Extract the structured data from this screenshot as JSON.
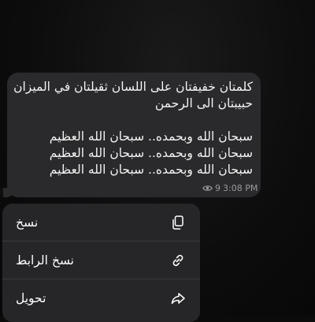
{
  "message": {
    "lines": [
      "كلمتان خفيفتان على اللسان ثقيلتان في الميزان",
      "حبيبتان الى الرحمن",
      "",
      "سبحان الله وبحمده.. سبحان الله العظيم",
      "سبحان الله وبحمده.. سبحان الله العظيم",
      "سبحان الله وبحمده.. سبحان الله العظيم"
    ],
    "views": "9",
    "time": "3:08 PM"
  },
  "context_menu": {
    "items": [
      {
        "label": "نسخ",
        "icon": "copy-icon"
      },
      {
        "label": "نسخ الرابط",
        "icon": "link-icon"
      },
      {
        "label": "تحويل",
        "icon": "forward-icon"
      }
    ]
  },
  "colors": {
    "background": "#0b0b0c",
    "bubble": "#2a2a2c",
    "menu": "#262628",
    "meta_text": "#9b9ba0"
  }
}
